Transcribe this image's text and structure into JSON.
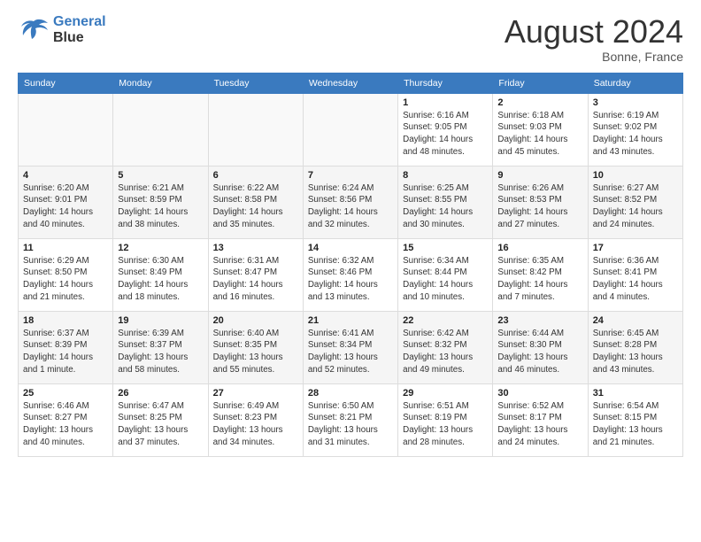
{
  "logo": {
    "line1": "General",
    "line2": "Blue"
  },
  "title": "August 2024",
  "location": "Bonne, France",
  "days_header": [
    "Sunday",
    "Monday",
    "Tuesday",
    "Wednesday",
    "Thursday",
    "Friday",
    "Saturday"
  ],
  "weeks": [
    [
      {
        "day": "",
        "info": ""
      },
      {
        "day": "",
        "info": ""
      },
      {
        "day": "",
        "info": ""
      },
      {
        "day": "",
        "info": ""
      },
      {
        "day": "1",
        "info": "Sunrise: 6:16 AM\nSunset: 9:05 PM\nDaylight: 14 hours\nand 48 minutes."
      },
      {
        "day": "2",
        "info": "Sunrise: 6:18 AM\nSunset: 9:03 PM\nDaylight: 14 hours\nand 45 minutes."
      },
      {
        "day": "3",
        "info": "Sunrise: 6:19 AM\nSunset: 9:02 PM\nDaylight: 14 hours\nand 43 minutes."
      }
    ],
    [
      {
        "day": "4",
        "info": "Sunrise: 6:20 AM\nSunset: 9:01 PM\nDaylight: 14 hours\nand 40 minutes."
      },
      {
        "day": "5",
        "info": "Sunrise: 6:21 AM\nSunset: 8:59 PM\nDaylight: 14 hours\nand 38 minutes."
      },
      {
        "day": "6",
        "info": "Sunrise: 6:22 AM\nSunset: 8:58 PM\nDaylight: 14 hours\nand 35 minutes."
      },
      {
        "day": "7",
        "info": "Sunrise: 6:24 AM\nSunset: 8:56 PM\nDaylight: 14 hours\nand 32 minutes."
      },
      {
        "day": "8",
        "info": "Sunrise: 6:25 AM\nSunset: 8:55 PM\nDaylight: 14 hours\nand 30 minutes."
      },
      {
        "day": "9",
        "info": "Sunrise: 6:26 AM\nSunset: 8:53 PM\nDaylight: 14 hours\nand 27 minutes."
      },
      {
        "day": "10",
        "info": "Sunrise: 6:27 AM\nSunset: 8:52 PM\nDaylight: 14 hours\nand 24 minutes."
      }
    ],
    [
      {
        "day": "11",
        "info": "Sunrise: 6:29 AM\nSunset: 8:50 PM\nDaylight: 14 hours\nand 21 minutes."
      },
      {
        "day": "12",
        "info": "Sunrise: 6:30 AM\nSunset: 8:49 PM\nDaylight: 14 hours\nand 18 minutes."
      },
      {
        "day": "13",
        "info": "Sunrise: 6:31 AM\nSunset: 8:47 PM\nDaylight: 14 hours\nand 16 minutes."
      },
      {
        "day": "14",
        "info": "Sunrise: 6:32 AM\nSunset: 8:46 PM\nDaylight: 14 hours\nand 13 minutes."
      },
      {
        "day": "15",
        "info": "Sunrise: 6:34 AM\nSunset: 8:44 PM\nDaylight: 14 hours\nand 10 minutes."
      },
      {
        "day": "16",
        "info": "Sunrise: 6:35 AM\nSunset: 8:42 PM\nDaylight: 14 hours\nand 7 minutes."
      },
      {
        "day": "17",
        "info": "Sunrise: 6:36 AM\nSunset: 8:41 PM\nDaylight: 14 hours\nand 4 minutes."
      }
    ],
    [
      {
        "day": "18",
        "info": "Sunrise: 6:37 AM\nSunset: 8:39 PM\nDaylight: 14 hours\nand 1 minute."
      },
      {
        "day": "19",
        "info": "Sunrise: 6:39 AM\nSunset: 8:37 PM\nDaylight: 13 hours\nand 58 minutes."
      },
      {
        "day": "20",
        "info": "Sunrise: 6:40 AM\nSunset: 8:35 PM\nDaylight: 13 hours\nand 55 minutes."
      },
      {
        "day": "21",
        "info": "Sunrise: 6:41 AM\nSunset: 8:34 PM\nDaylight: 13 hours\nand 52 minutes."
      },
      {
        "day": "22",
        "info": "Sunrise: 6:42 AM\nSunset: 8:32 PM\nDaylight: 13 hours\nand 49 minutes."
      },
      {
        "day": "23",
        "info": "Sunrise: 6:44 AM\nSunset: 8:30 PM\nDaylight: 13 hours\nand 46 minutes."
      },
      {
        "day": "24",
        "info": "Sunrise: 6:45 AM\nSunset: 8:28 PM\nDaylight: 13 hours\nand 43 minutes."
      }
    ],
    [
      {
        "day": "25",
        "info": "Sunrise: 6:46 AM\nSunset: 8:27 PM\nDaylight: 13 hours\nand 40 minutes."
      },
      {
        "day": "26",
        "info": "Sunrise: 6:47 AM\nSunset: 8:25 PM\nDaylight: 13 hours\nand 37 minutes."
      },
      {
        "day": "27",
        "info": "Sunrise: 6:49 AM\nSunset: 8:23 PM\nDaylight: 13 hours\nand 34 minutes."
      },
      {
        "day": "28",
        "info": "Sunrise: 6:50 AM\nSunset: 8:21 PM\nDaylight: 13 hours\nand 31 minutes."
      },
      {
        "day": "29",
        "info": "Sunrise: 6:51 AM\nSunset: 8:19 PM\nDaylight: 13 hours\nand 28 minutes."
      },
      {
        "day": "30",
        "info": "Sunrise: 6:52 AM\nSunset: 8:17 PM\nDaylight: 13 hours\nand 24 minutes."
      },
      {
        "day": "31",
        "info": "Sunrise: 6:54 AM\nSunset: 8:15 PM\nDaylight: 13 hours\nand 21 minutes."
      }
    ]
  ]
}
